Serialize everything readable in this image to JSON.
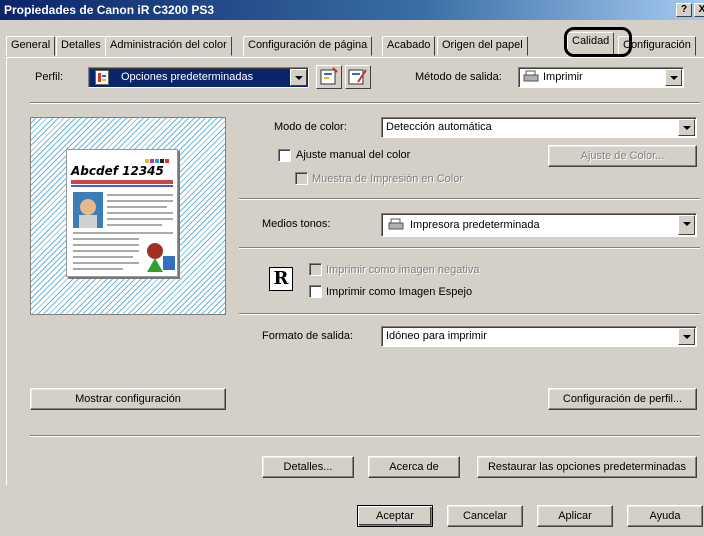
{
  "window": {
    "title": "Propiedades de Canon iR C3200 PS3",
    "help_btn": "?",
    "close_btn": "X"
  },
  "tabs": [
    {
      "label": "General"
    },
    {
      "label": "Detalles"
    },
    {
      "label": "Administración del color"
    },
    {
      "label": "Configuración de página"
    },
    {
      "label": "Acabado"
    },
    {
      "label": "Origen del papel"
    },
    {
      "label": "Calidad",
      "active": true
    },
    {
      "label": "Configuración"
    }
  ],
  "profile": {
    "label": "Perfil:",
    "value": "Opciones predeterminadas"
  },
  "output_method": {
    "label": "Método de salida:",
    "value": "Imprimir"
  },
  "preview": {
    "sample_text": "Abcdef 12345"
  },
  "color_mode": {
    "label": "Modo de color:",
    "value": "Detección automática"
  },
  "manual_color": {
    "label": "Ajuste manual del color",
    "checked": false
  },
  "color_settings_btn": "Ajuste de Color...",
  "color_sample": {
    "label": "Muestra de Impresión en Color",
    "checked": false
  },
  "halftones": {
    "label": "Medios tonos:",
    "value": "Impresora predeterminada"
  },
  "negative": {
    "label": "Imprimir como imagen negativa",
    "checked": false
  },
  "mirror": {
    "label": "Imprimir como Imagen Espejo",
    "checked": false
  },
  "mirror_icon_glyph": "R",
  "output_format": {
    "label": "Formato de salida:",
    "value": "Idóneo para imprimir"
  },
  "show_settings_btn": "Mostrar configuración",
  "profile_settings_btn": "Configuración de perfil...",
  "details_btn": "Detalles...",
  "about_btn": "Acerca de",
  "restore_btn": "Restaurar las opciones predeterminadas",
  "footer": {
    "ok": "Aceptar",
    "cancel": "Cancelar",
    "apply": "Aplicar",
    "help": "Ayuda"
  }
}
